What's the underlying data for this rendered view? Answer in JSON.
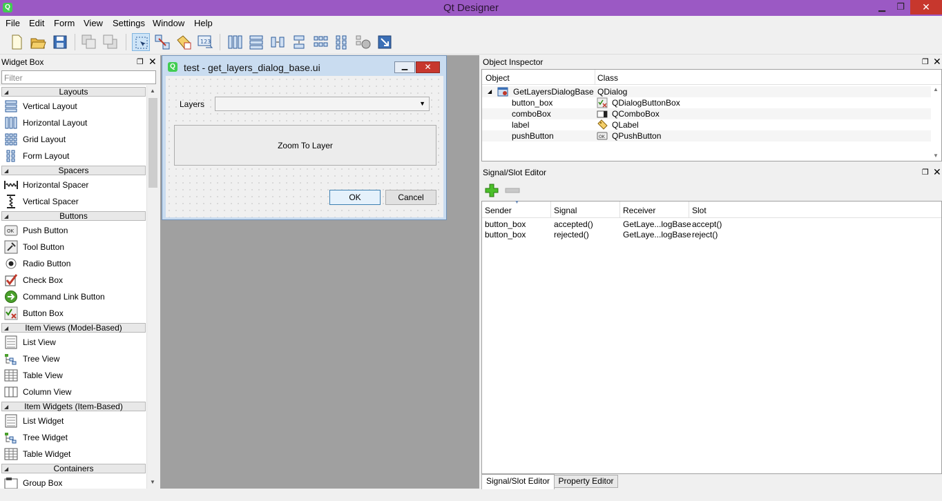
{
  "window": {
    "title": "Qt Designer",
    "minimize": "▁",
    "maximize": "❐",
    "close": "✕"
  },
  "menu": [
    "File",
    "Edit",
    "Form",
    "View",
    "Settings",
    "Window",
    "Help"
  ],
  "widget_box": {
    "title": "Widget Box",
    "filter_placeholder": "Filter",
    "categories": [
      "Layouts",
      "Spacers",
      "Buttons",
      "Item Views (Model-Based)",
      "Item Widgets (Item-Based)",
      "Containers"
    ],
    "items": {
      "layouts": [
        "Vertical Layout",
        "Horizontal Layout",
        "Grid Layout",
        "Form Layout"
      ],
      "spacers": [
        "Horizontal Spacer",
        "Vertical Spacer"
      ],
      "buttons": [
        "Push Button",
        "Tool Button",
        "Radio Button",
        "Check Box",
        "Command Link Button",
        "Button Box"
      ],
      "item_views": [
        "List View",
        "Tree View",
        "Table View",
        "Column View"
      ],
      "item_widgets": [
        "List Widget",
        "Tree Widget",
        "Table Widget"
      ],
      "containers": [
        "Group Box"
      ]
    }
  },
  "form": {
    "title": "test - get_layers_dialog_base.ui",
    "label": "Layers",
    "zoom_button": "Zoom To Layer",
    "ok": "OK",
    "cancel": "Cancel"
  },
  "object_inspector": {
    "title": "Object Inspector",
    "headers": [
      "Object",
      "Class"
    ],
    "root": {
      "object": "GetLayersDialogBase",
      "class": "QDialog"
    },
    "children": [
      {
        "object": "button_box",
        "class": "QDialogButtonBox"
      },
      {
        "object": "comboBox",
        "class": "QComboBox"
      },
      {
        "object": "label",
        "class": "QLabel"
      },
      {
        "object": "pushButton",
        "class": "QPushButton"
      }
    ]
  },
  "signal_slot": {
    "title": "Signal/Slot Editor",
    "headers": [
      "Sender",
      "Signal",
      "Receiver",
      "Slot"
    ],
    "rows": [
      {
        "sender": "button_box",
        "signal": "accepted()",
        "receiver": "GetLaye...logBase",
        "slot": "accept()"
      },
      {
        "sender": "button_box",
        "signal": "rejected()",
        "receiver": "GetLaye...logBase",
        "slot": "reject()"
      }
    ]
  },
  "tabs": [
    "Signal/Slot Editor",
    "Property Editor"
  ]
}
